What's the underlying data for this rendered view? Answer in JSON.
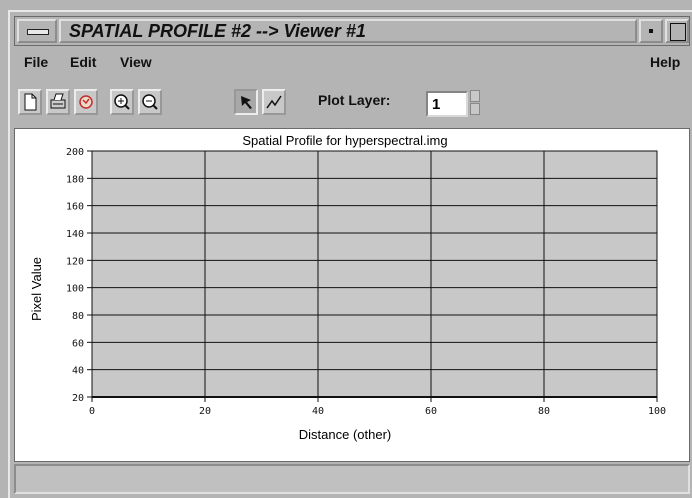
{
  "window": {
    "title": "SPATIAL PROFILE #2 --> Viewer #1"
  },
  "menubar": {
    "file": "File",
    "edit": "Edit",
    "view": "View",
    "help": "Help"
  },
  "toolbar": {
    "icons": [
      "new-icon",
      "print-icon",
      "reset-icon",
      "zoom-in-icon",
      "zoom-out-icon",
      "select-arrow-icon",
      "draw-line-icon"
    ],
    "plot_layer_label": "Plot Layer:",
    "plot_layer_value": "1"
  },
  "chart_data": {
    "type": "line",
    "title": "Spatial Profile for hyperspectral.img",
    "xlabel": "Distance (other)",
    "ylabel": "Pixel Value",
    "xlim": [
      0,
      100
    ],
    "ylim": [
      20,
      200
    ],
    "xticks": [
      0,
      20,
      40,
      60,
      80,
      100
    ],
    "yticks": [
      20,
      40,
      60,
      80,
      100,
      120,
      140,
      160,
      180,
      200
    ],
    "grid": true,
    "plot_background": "#c8c8c8",
    "series": []
  },
  "status": {
    "text": ""
  }
}
